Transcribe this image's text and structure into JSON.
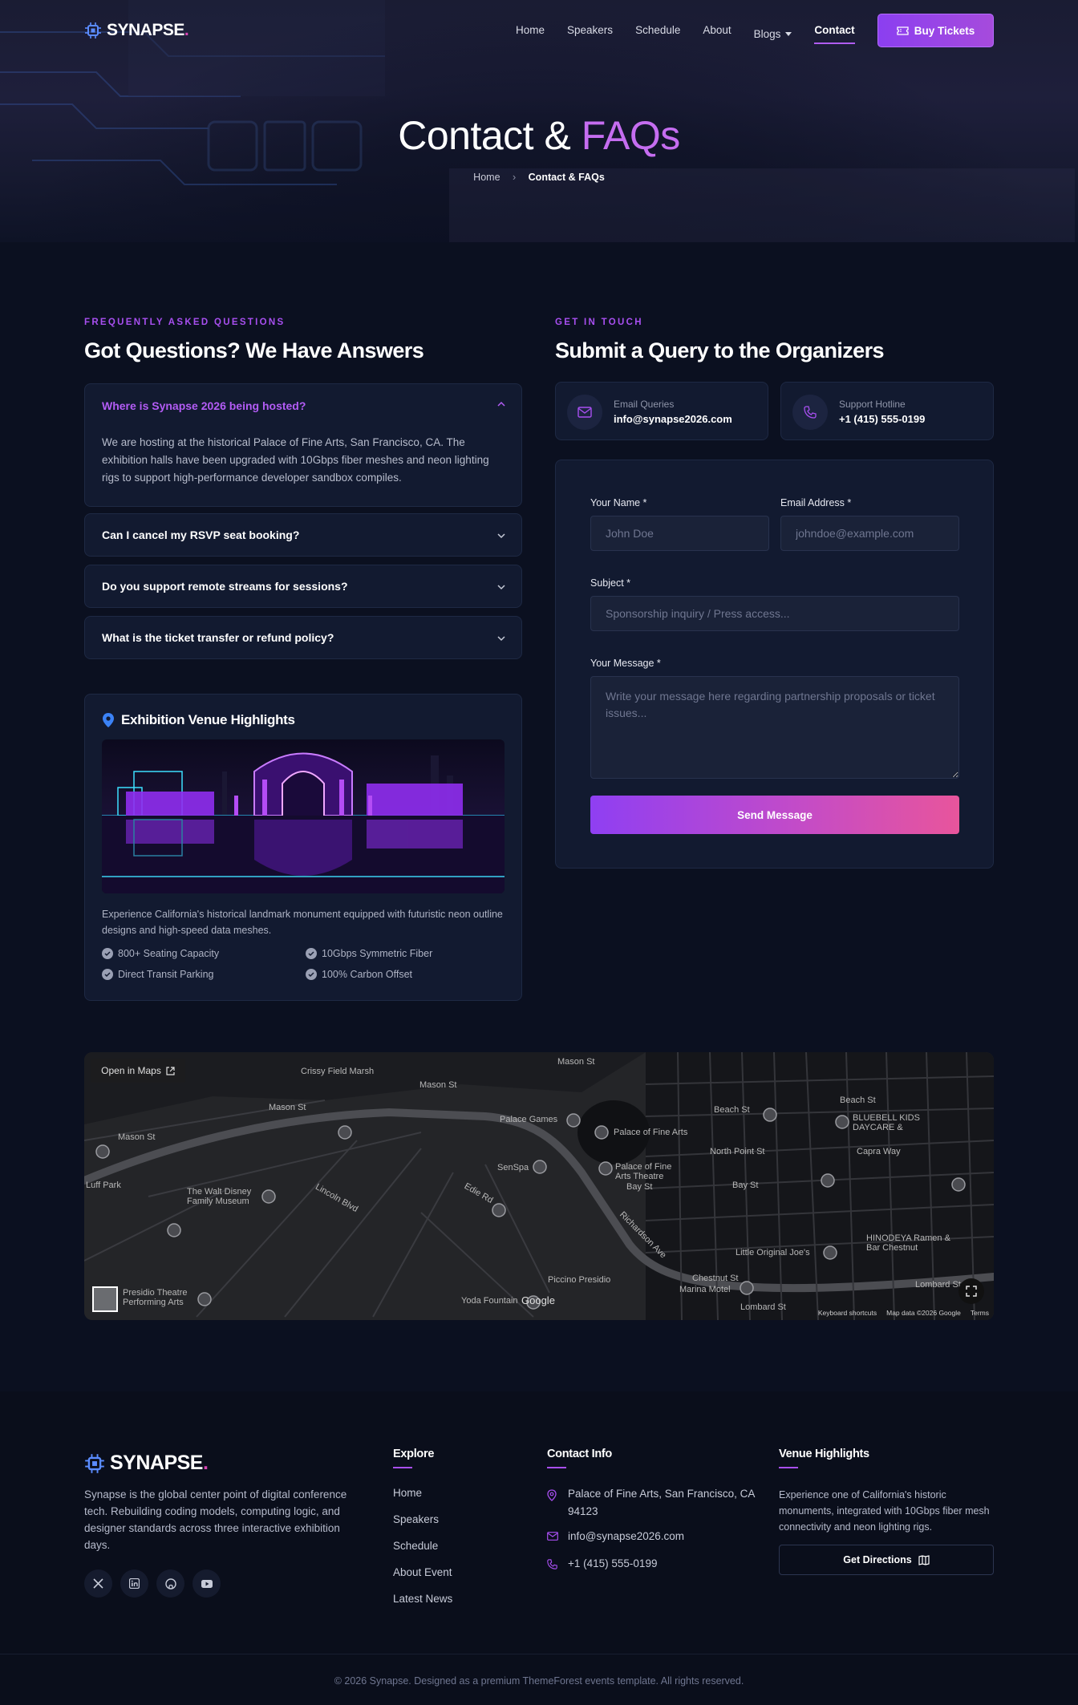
{
  "brand": {
    "name": "SYNAPSE",
    "dot": "."
  },
  "nav": {
    "items": [
      "Home",
      "Speakers",
      "Schedule",
      "About",
      "Blogs",
      "Contact"
    ],
    "active": "Contact",
    "cta": "Buy Tickets"
  },
  "hero": {
    "title_main": "Contact &",
    "title_accent": "FAQs",
    "breadcrumb": [
      "Home",
      "Contact & FAQs"
    ]
  },
  "faq": {
    "eyebrow": "FREQUENTLY ASKED QUESTIONS",
    "title": "Got Questions? We Have Answers",
    "items": [
      {
        "question": "Where is Synapse 2026 being hosted?",
        "answer": "We are hosting at the historical Palace of Fine Arts, San Francisco, CA. The exhibition halls have been upgraded with 10Gbps fiber meshes and neon lighting rigs to support high-performance developer sandbox compiles.",
        "open": true
      },
      {
        "question": "Can I cancel my RSVP seat booking?",
        "open": false
      },
      {
        "question": "Do you support remote streams for sessions?",
        "open": false
      },
      {
        "question": "What is the ticket transfer or refund policy?",
        "open": false
      }
    ]
  },
  "venue": {
    "title": "Exhibition Venue Highlights",
    "description": "Experience California's historical landmark monument equipped with futuristic neon outline designs and high-speed data meshes.",
    "features": [
      "800+ Seating Capacity",
      "10Gbps Symmetric Fiber",
      "Direct Transit Parking",
      "100% Carbon Offset"
    ]
  },
  "contact": {
    "eyebrow": "GET IN TOUCH",
    "title": "Submit a Query to the Organizers",
    "email_label": "Email Queries",
    "email_value": "info@synapse2026.com",
    "phone_label": "Support Hotline",
    "phone_value": "+1 (415) 555-0199"
  },
  "form": {
    "name_label": "Your Name *",
    "name_placeholder": "John Doe",
    "email_label": "Email Address *",
    "email_placeholder": "johndoe@example.com",
    "subject_label": "Subject *",
    "subject_placeholder": "Sponsorship inquiry / Press access...",
    "message_label": "Your Message *",
    "message_placeholder": "Write your message here regarding partnership proposals or ticket issues...",
    "submit": "Send Message"
  },
  "map": {
    "open_label": "Open in Maps",
    "labels": {
      "crissy": "Crissy Field Marsh",
      "mason1": "Mason St",
      "mason2": "Mason St",
      "mason3": "Mason St",
      "mason4": "Mason St",
      "palace_games": "Palace Games",
      "palace_fine_arts": "Palace of Fine Arts",
      "palace_theatre": "Palace of Fine Arts Theatre",
      "senspa": "SenSpa",
      "disney": "The Walt Disney Family Museum",
      "presidio_theatre": "Presidio Theatre Performing Arts",
      "beach": "Beach St",
      "beach2": "Beach St",
      "north_point": "North Point St",
      "bay": "Bay St",
      "bay2": "Bay St",
      "little_joe": "Little Original Joe's",
      "chestnut": "Chestnut St",
      "marina_motel": "Marina Motel",
      "lombard": "Lombard St",
      "lombard2": "Lombard St",
      "bluebell": "BLUEBELL KIDS DAYCARE &",
      "hinodeya": "HINODEYA Ramen & Bar Chestnut",
      "capra": "Capra Way",
      "yoda": "Yoda Fountain",
      "google": "Google",
      "piccino": "Piccino Presidio",
      "richardson": "Richardson Ave",
      "lincoln": "Lincoln Blvd",
      "edie": "Edie Rd",
      "luff": "Luff Park"
    },
    "footer": [
      "Keyboard shortcuts",
      "Map data ©2026 Google",
      "Terms"
    ]
  },
  "footer": {
    "about": "Synapse is the global center point of digital conference tech. Rebuilding coding models, computing logic, and designer standards across three interactive exhibition days.",
    "socials": [
      "x-icon",
      "linkedin-icon",
      "github-icon",
      "youtube-icon"
    ],
    "explore_title": "Explore",
    "explore": [
      "Home",
      "Speakers",
      "Schedule",
      "About Event",
      "Latest News"
    ],
    "contact_title": "Contact Info",
    "address": "Palace of Fine Arts, San Francisco, CA 94123",
    "email": "info@synapse2026.com",
    "phone": "+1 (415) 555-0199",
    "venue_title": "Venue Highlights",
    "venue_text": "Experience one of California's historic monuments, integrated with 10Gbps fiber mesh connectivity and neon lighting rigs.",
    "directions": "Get Directions",
    "copyright": "© 2026 Synapse. Designed as a premium ThemeForest events template. All rights reserved."
  },
  "colors": {
    "accent": "#a84ff0",
    "bg": "#0b1020",
    "panel": "#121a30",
    "gradient_end": "#e8559c"
  }
}
